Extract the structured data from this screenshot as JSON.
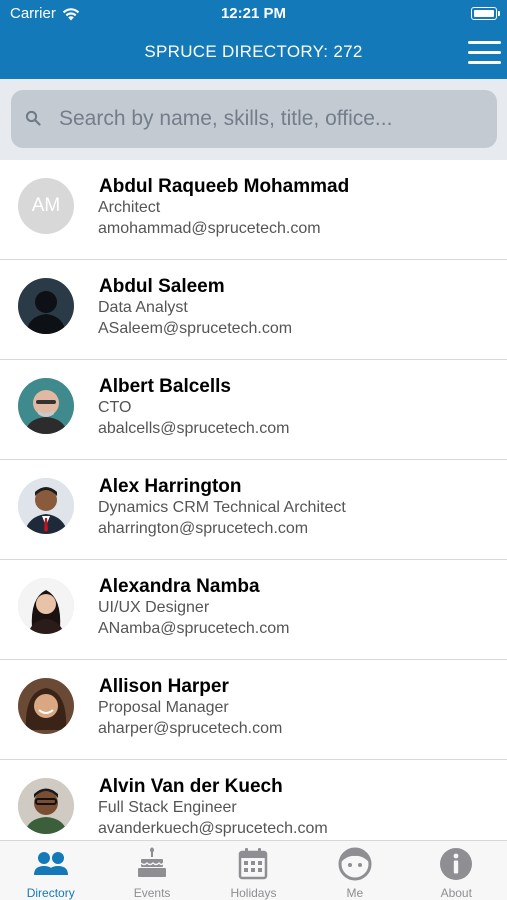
{
  "status_bar": {
    "carrier": "Carrier",
    "time": "12:21 PM"
  },
  "header": {
    "title": "SPRUCE DIRECTORY: 272"
  },
  "search": {
    "placeholder": "Search by name, skills, title, office..."
  },
  "employees": [
    {
      "name": "Abdul Raqueeb Mohammad",
      "title": "Architect",
      "email": "amohammad@sprucetech.com",
      "initials": "AM"
    },
    {
      "name": "Abdul Saleem",
      "title": "Data Analyst",
      "email": "ASaleem@sprucetech.com"
    },
    {
      "name": "Albert Balcells",
      "title": "CTO",
      "email": "abalcells@sprucetech.com"
    },
    {
      "name": "Alex Harrington",
      "title": "Dynamics CRM Technical Architect",
      "email": "aharrington@sprucetech.com"
    },
    {
      "name": "Alexandra Namba",
      "title": "UI/UX Designer",
      "email": "ANamba@sprucetech.com"
    },
    {
      "name": "Allison Harper",
      "title": "Proposal Manager",
      "email": "aharper@sprucetech.com"
    },
    {
      "name": "Alvin Van der Kuech",
      "title": "Full Stack Engineer",
      "email": "avanderkuech@sprucetech.com"
    }
  ],
  "tabs": [
    {
      "label": "Directory",
      "icon": "people-icon",
      "active": true
    },
    {
      "label": "Events",
      "icon": "cake-icon",
      "active": false
    },
    {
      "label": "Holidays",
      "icon": "calendar-icon",
      "active": false
    },
    {
      "label": "Me",
      "icon": "face-icon",
      "active": false
    },
    {
      "label": "About",
      "icon": "info-icon",
      "active": false
    }
  ],
  "colors": {
    "brand": "#1479b8",
    "tab_inactive": "#8e8e93",
    "search_bg": "#c3cad2"
  }
}
